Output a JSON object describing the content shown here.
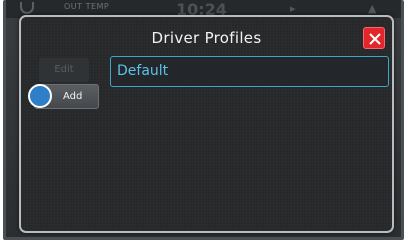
{
  "status_bar": {
    "out_temp_label": "OUT TEMP",
    "time": "10:24"
  },
  "dialog": {
    "title": "Driver Profiles",
    "close_icon": "close-icon",
    "edit_label": "Edit",
    "add_label": "Add",
    "profiles": [
      "Default"
    ],
    "selected_profile": "Default"
  },
  "colors": {
    "accent": "#3fa6c9",
    "profile_text": "#5cc3e8",
    "close": "#e2262c",
    "add_indicator": "#2f7ec8"
  }
}
